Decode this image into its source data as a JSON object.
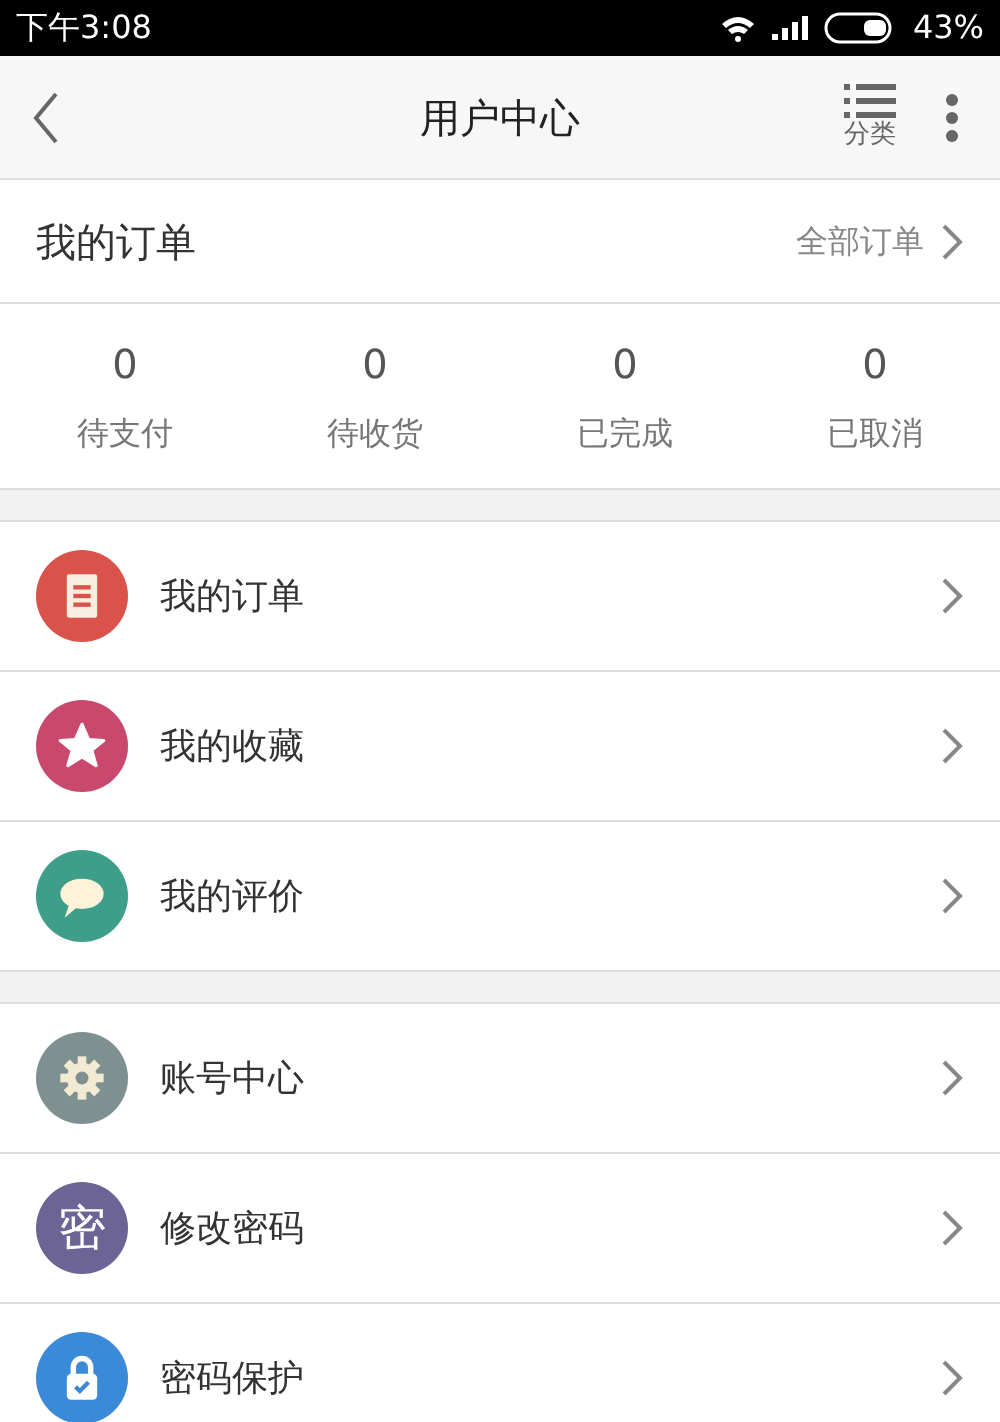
{
  "status_bar": {
    "time": "下午3:08",
    "battery": "43%"
  },
  "header": {
    "title": "用户中心",
    "category_label": "分类"
  },
  "orders": {
    "title": "我的订单",
    "all_link": "全部订单",
    "counts": [
      {
        "count": "0",
        "label": "待支付"
      },
      {
        "count": "0",
        "label": "待收货"
      },
      {
        "count": "0",
        "label": "已完成"
      },
      {
        "count": "0",
        "label": "已取消"
      }
    ]
  },
  "menu_groups": [
    [
      {
        "label": "我的订单",
        "kind": "document",
        "color": "#d9534a"
      },
      {
        "label": "我的收藏",
        "kind": "star",
        "color": "#c9496e"
      },
      {
        "label": "我的评价",
        "kind": "chat",
        "color": "#3f9e8a"
      }
    ],
    [
      {
        "label": "账号中心",
        "kind": "gear",
        "color": "#7f9090"
      },
      {
        "label": "修改密码",
        "kind": "glyph",
        "glyph": "密",
        "color": "#6b6495"
      },
      {
        "label": "密码保护",
        "kind": "lock",
        "color": "#3b8ad8"
      }
    ]
  ]
}
